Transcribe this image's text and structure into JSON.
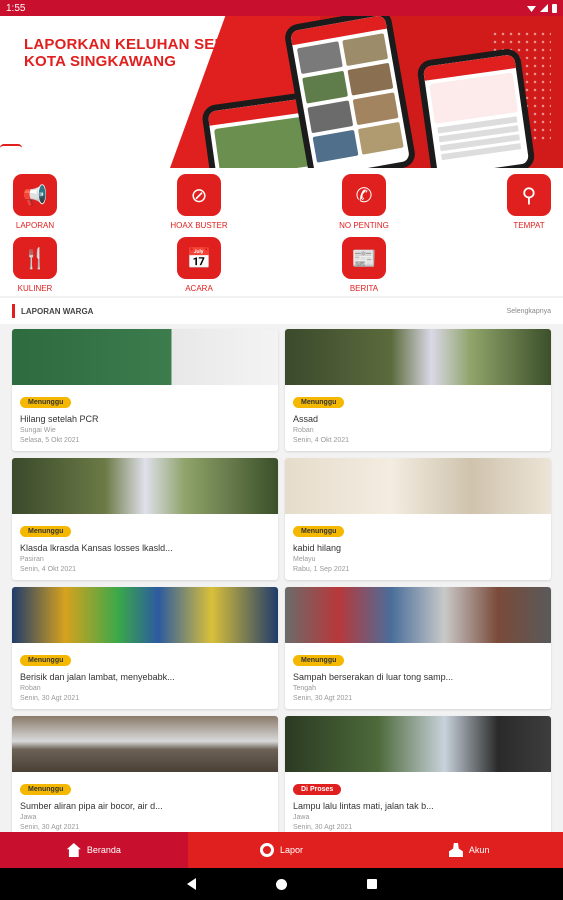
{
  "status_bar": {
    "time": "1:55"
  },
  "banner": {
    "title_line1": "LAPORKAN KELUHAN SEPUTAR",
    "title_line2": "KOTA SINGKAWANG"
  },
  "menu": [
    {
      "label": "LAPORAN",
      "icon": "megaphone-icon",
      "glyph": "📢"
    },
    {
      "label": "HOAX BUSTER",
      "icon": "ban-icon",
      "glyph": "⊘"
    },
    {
      "label": "NO PENTING",
      "icon": "phone-icon",
      "glyph": "✆"
    },
    {
      "label": "TEMPAT",
      "icon": "location-pin-icon",
      "glyph": "⚲"
    },
    {
      "label": "KULINER",
      "icon": "fork-knife-icon",
      "glyph": "🍴"
    },
    {
      "label": "ACARA",
      "icon": "calendar-icon",
      "glyph": "📅"
    },
    {
      "label": "BERITA",
      "icon": "newspaper-icon",
      "glyph": "📰"
    }
  ],
  "section": {
    "title": "LAPORAN WARGA",
    "more": "Selengkapnya"
  },
  "reports": [
    {
      "status": "Menunggu",
      "status_type": "wait",
      "title": "Hilang setelah PCR",
      "location": "Sungai Wie",
      "date": "Selasa, 5 Okt 2021"
    },
    {
      "status": "Menunggu",
      "status_type": "wait",
      "title": "Assad",
      "location": "Roban",
      "date": "Senin, 4 Okt 2021"
    },
    {
      "status": "Menunggu",
      "status_type": "wait",
      "title": "Klasda lkrasda Kansas losses lkasld...",
      "location": "Pasiran",
      "date": "Senin, 4 Okt 2021"
    },
    {
      "status": "Menunggu",
      "status_type": "wait",
      "title": "kabid hilang",
      "location": "Melayu",
      "date": "Rabu, 1 Sep 2021"
    },
    {
      "status": "Menunggu",
      "status_type": "wait",
      "title": "Berisik dan jalan lambat, menyebabk...",
      "location": "Roban",
      "date": "Senin, 30 Agt 2021"
    },
    {
      "status": "Menunggu",
      "status_type": "wait",
      "title": "Sampah berserakan di luar tong samp...",
      "location": "Tengah",
      "date": "Senin, 30 Agt 2021"
    },
    {
      "status": "Menunggu",
      "status_type": "wait",
      "title": "Sumber aliran pipa air bocor, air d...",
      "location": "Jawa",
      "date": "Senin, 30 Agt 2021"
    },
    {
      "status": "Di Proses",
      "status_type": "proc",
      "title": "Lampu lalu lintas mati, jalan tak b...",
      "location": "Jawa",
      "date": "Senin, 30 Agt 2021"
    }
  ],
  "bottom_nav": [
    {
      "label": "Beranda",
      "icon": "home-icon"
    },
    {
      "label": "Lapor",
      "icon": "lapor-icon"
    },
    {
      "label": "Akun",
      "icon": "user-icon"
    }
  ],
  "colors": {
    "primary": "#e0201f",
    "wait_badge": "#f5b800"
  }
}
